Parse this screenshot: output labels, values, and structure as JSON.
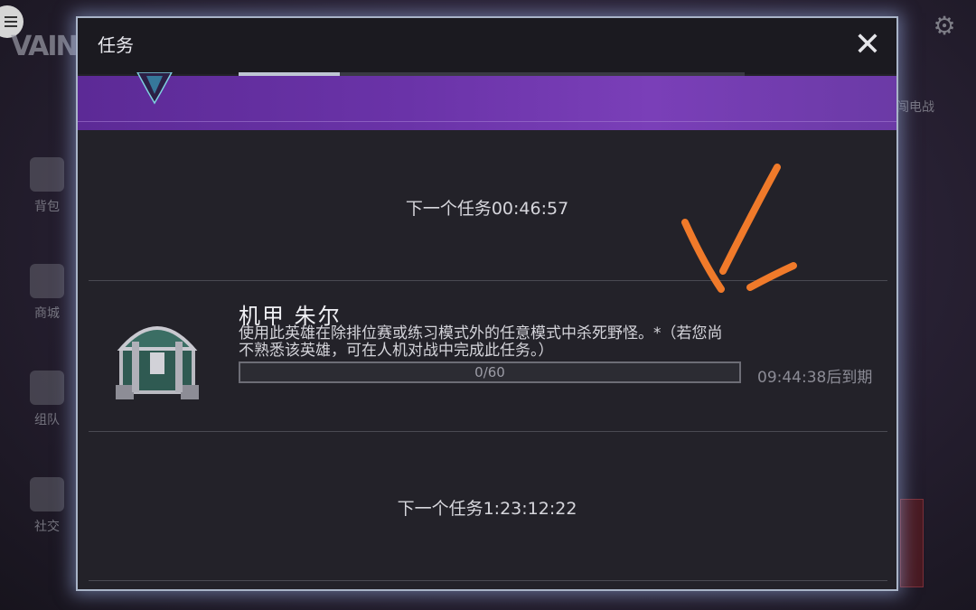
{
  "background": {
    "logo_text": "VAINGLO",
    "side_nav": [
      {
        "label": "背包",
        "icon": "backpack-icon"
      },
      {
        "label": "商城",
        "icon": "shop-cart-icon"
      },
      {
        "label": "组队",
        "icon": "team-icon"
      },
      {
        "label": "社交",
        "icon": "social-icon"
      }
    ],
    "right_hint": "闯电战",
    "settings_icon": "gear-icon",
    "menu_icon": "hamburger-icon"
  },
  "dialog": {
    "title": "任务",
    "close_icon": "close-icon",
    "scroll_position": 0.2,
    "next_task_1": "下一个任务00:46:57",
    "quest": {
      "name": "机甲 朱尔",
      "description": "使用此英雄在除排位赛或练习模式外的任意模式中杀死野怪。*（若您尚不熟悉该英雄，可在人机对战中完成此任务。）",
      "progress_text": "0/60",
      "progress_value": 0,
      "progress_max": 60,
      "expiry": "09:44:38后到期",
      "reward_icon": "treasure-chest-icon"
    },
    "next_task_2": "下一个任务1:23:12:22"
  },
  "colors": {
    "banner": "#6a33a8",
    "dialog_border": "#a9b4c8",
    "annotation_arrow": "#f07a2a"
  }
}
